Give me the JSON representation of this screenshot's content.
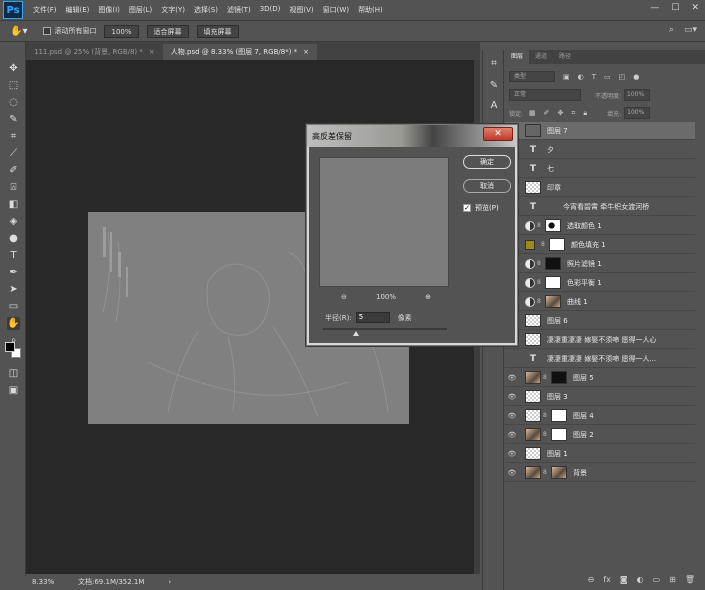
{
  "app": {
    "logo": "Ps",
    "menu": [
      "文件(F)",
      "编辑(E)",
      "图像(I)",
      "图层(L)",
      "文字(Y)",
      "选择(S)",
      "滤镜(T)",
      "3D(D)",
      "视图(V)",
      "窗口(W)",
      "帮助(H)"
    ],
    "window_controls": [
      "—",
      "☐",
      "✕"
    ]
  },
  "options": {
    "tool_icon": "hand-icon",
    "scroll_all_label": "滚动所有窗口",
    "zoom_value": "100%",
    "fit_screen_label": "适合屏幕",
    "fill_screen_label": "填充屏幕"
  },
  "tabs": [
    {
      "label": "111.psd @ 25% (背景, RGB/8) *",
      "close": "×"
    },
    {
      "label": "人物.psd @ 8.33% (图层 7, RGB/8*) *",
      "close": "×"
    }
  ],
  "status": {
    "zoom": "8.33%",
    "doc": "文档:69.1M/352.1M",
    "arrow": "›"
  },
  "dialog": {
    "title": "高反差保留",
    "close": "✕",
    "ok_label": "确定",
    "cancel_label": "取消",
    "preview_label": "预览(P)",
    "preview_checked": true,
    "zoom_out": "⊖",
    "zoom_in": "⊕",
    "zoom_level": "100%",
    "radius_label": "半径(R):",
    "radius_value": "5",
    "radius_unit": "像素"
  },
  "panel": {
    "tabs": [
      "图层",
      "通道",
      "路径"
    ],
    "filter_placeholder": "类型",
    "blend_mode": "正常",
    "opacity_label": "不透明度:",
    "opacity_value": "100%",
    "lock_label": "锁定:",
    "fill_label": "填充:",
    "fill_value": "100%",
    "layers": [
      {
        "name": "图层 7",
        "kind": "pixel",
        "thumb": "dark",
        "visible": false,
        "selected": true
      },
      {
        "name": "夕",
        "kind": "text",
        "visible": false
      },
      {
        "name": "七",
        "kind": "text",
        "visible": false
      },
      {
        "name": "印章",
        "kind": "pixel",
        "thumb": "checker",
        "visible": false
      },
      {
        "name": "今宵看碧霄 牵牛织女渡河桥",
        "kind": "text",
        "visible": false,
        "center": true
      },
      {
        "name": "选取颜色 1",
        "kind": "adjust",
        "mask": "mixed",
        "visible": false
      },
      {
        "name": "颜色填充 1",
        "kind": "fill",
        "mask": "white",
        "visible": false
      },
      {
        "name": "照片滤镜 1",
        "kind": "adjust",
        "mask": "black",
        "visible": false
      },
      {
        "name": "色彩平衡 1",
        "kind": "adjust",
        "mask": "white",
        "visible": false
      },
      {
        "name": "曲线 1",
        "kind": "adjust",
        "mask": "photo",
        "visible": false
      },
      {
        "name": "图层 6",
        "kind": "pixel",
        "thumb": "checker",
        "visible": false
      },
      {
        "name": "凄凄重凄凄 嫁娶不须啼 愿得一人心",
        "kind": "pixel",
        "thumb": "checker",
        "visible": false
      },
      {
        "name": "凄凄重凄凄 嫁娶不须啼 愿得一人...",
        "kind": "text",
        "visible": false
      },
      {
        "name": "图层 5",
        "kind": "pixel-mask",
        "thumb": "photo",
        "mask": "black",
        "visible": true
      },
      {
        "name": "图层 3",
        "kind": "pixel",
        "thumb": "checker",
        "visible": true
      },
      {
        "name": "图层 4",
        "kind": "pixel-mask",
        "thumb": "checker",
        "mask": "white",
        "visible": true
      },
      {
        "name": "图层 2",
        "kind": "pixel-mask",
        "thumb": "photo",
        "mask": "white",
        "visible": true
      },
      {
        "name": "图层 1",
        "kind": "pixel",
        "thumb": "checker",
        "visible": true
      },
      {
        "name": "背景",
        "kind": "pixel-mask",
        "thumb": "photo",
        "mask": "photo",
        "visible": true
      }
    ],
    "footer_icons": [
      "link-icon",
      "fx-icon",
      "mask-icon",
      "adjustment-icon",
      "folder-icon",
      "new-layer-icon",
      "trash-icon"
    ]
  },
  "colors": {
    "ui_bg": "#535353",
    "canvas_bg": "#282828",
    "doc_gray": "#808080",
    "accent_blue": "#31a8ff"
  }
}
